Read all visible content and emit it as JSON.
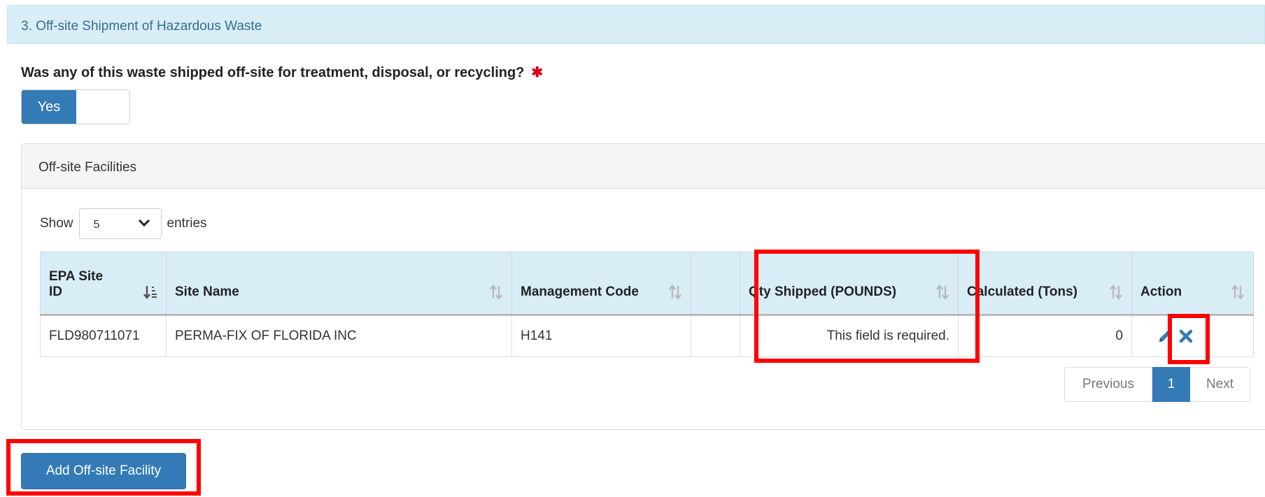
{
  "section": {
    "title": "3. Off-site Shipment of Hazardous Waste"
  },
  "question": {
    "text": "Was any of this waste shipped off-site for treatment, disposal, or recycling?",
    "required_mark": "✱",
    "toggle_value": "Yes"
  },
  "panel": {
    "title": "Off-site Facilities",
    "length": {
      "show": "Show",
      "value": "5",
      "entries": "entries"
    },
    "table": {
      "headers": [
        "EPA Site ID",
        "Site Name",
        "Management Code",
        "",
        "Qty Shipped (POUNDS)",
        "Calculated (Tons)",
        "Action"
      ],
      "rows": [
        {
          "epa_id": "FLD980711071",
          "site_name": "PERMA-FIX OF FLORIDA INC",
          "mgmt_code": "H141",
          "blank": "",
          "qty": "This field is required.",
          "tons": "0"
        }
      ]
    },
    "pagination": {
      "previous": "Previous",
      "current": "1",
      "next": "Next"
    }
  },
  "add_button": {
    "label": "Add Off-site Facility"
  },
  "colors": {
    "primary": "#337ab7",
    "error": "#d9001b",
    "info_bg": "#d9edf7",
    "highlight": "#ff0000"
  }
}
